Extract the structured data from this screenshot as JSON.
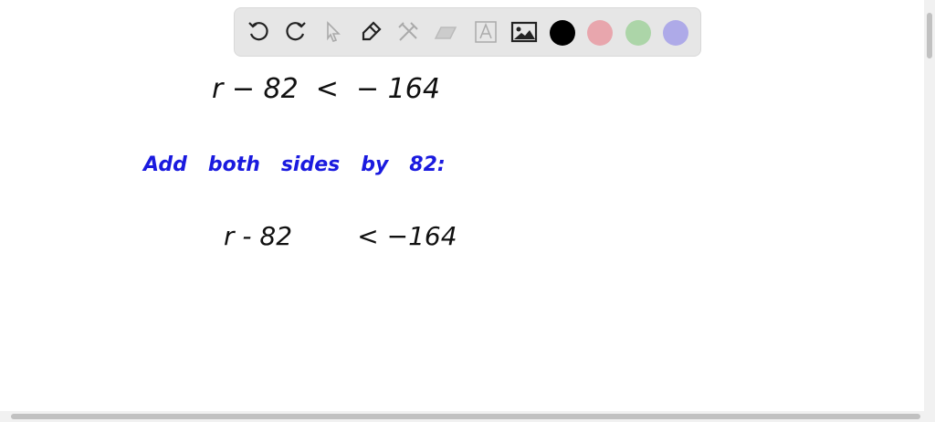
{
  "toolbar": {
    "tools": [
      "undo-icon",
      "redo-icon",
      "select-icon",
      "pen-icon",
      "tools-icon",
      "eraser-icon",
      "text-icon",
      "image-icon"
    ],
    "colors": {
      "black": "#000000",
      "pink": "#e8a6ad",
      "green": "#acd5a8",
      "purple": "#aeaae8"
    }
  },
  "canvas": {
    "line1": "r − 82  <  − 164",
    "note": "Add   both   sides   by   82:",
    "line2": "r - 82        < −164"
  }
}
